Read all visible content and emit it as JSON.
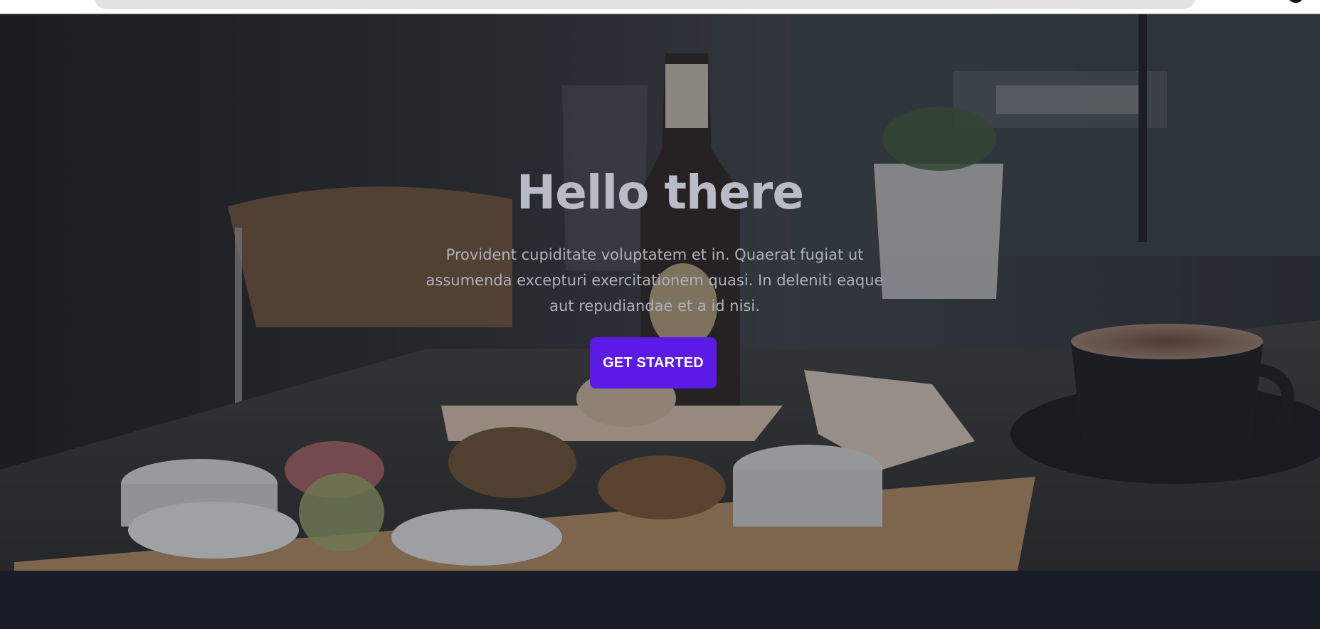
{
  "hero": {
    "title": "Hello there",
    "text": "Provident cupiditate voluptatem et in. Quaerat fugiat ut assumenda excepturi exercitationem quasi. In deleniti eaque aut repudiandae et a id nisi.",
    "cta_label": "GET STARTED",
    "background_image": "cafe-table-food-photo"
  },
  "colors": {
    "cta": "#5b1ae6",
    "footer": "#181d27",
    "title": "#b9bcc6",
    "text": "#aeb1bb"
  }
}
